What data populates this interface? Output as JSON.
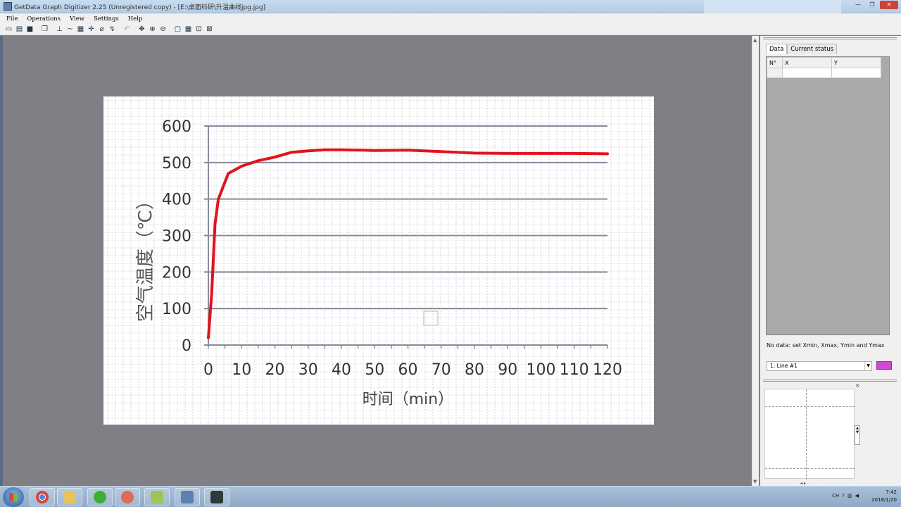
{
  "window": {
    "title": "GetData Graph Digitizer 2.25 (Unregistered copy) - [E:\\桌面科研\\升温曲线jpg.jpg]",
    "controls": {
      "minimize": "—",
      "restore": "❐",
      "close": "✕"
    }
  },
  "menu": [
    "File",
    "Operations",
    "View",
    "Settings",
    "Help"
  ],
  "toolbar": {
    "icons": [
      "open-icon",
      "scan-icon",
      "save-icon",
      "copy-icon",
      "point-capture-icon",
      "line-digitize-icon",
      "area-icon",
      "axis-set-icon",
      "eraser-icon",
      "auto-trace-icon",
      "undo-icon",
      "pan-icon",
      "zoom-in-icon",
      "zoom-out-icon",
      "fit-icon",
      "grid-icon",
      "select-area-icon",
      "clear-icon"
    ]
  },
  "panel": {
    "tabs": [
      "Data",
      "Current status"
    ],
    "table_headers": [
      "N°",
      "X",
      "Y"
    ],
    "status": "No data: set Xmin, Xmax, Ymin and Ymax",
    "line_select": "1: Line #1",
    "line_color": "#d547d5",
    "magnifier_close": "×",
    "hscroll": "◂ ▸"
  },
  "chart_data": {
    "type": "line",
    "title": "",
    "xlabel": "时间（min）",
    "ylabel": "空气温度（℃）",
    "x_ticks": [
      "0",
      "10",
      "20",
      "30",
      "40",
      "50",
      "60",
      "70",
      "80",
      "90",
      "100",
      "110",
      "120"
    ],
    "y_ticks": [
      "0",
      "100",
      "200",
      "300",
      "400",
      "500",
      "600"
    ],
    "xlim": [
      0,
      120
    ],
    "ylim": [
      0,
      600
    ],
    "grid": "horizontal",
    "series_color": "#e0141a",
    "x": [
      0,
      1,
      2,
      3,
      6,
      10,
      15,
      20,
      25,
      30,
      35,
      40,
      50,
      60,
      70,
      80,
      90,
      100,
      110,
      120
    ],
    "values": [
      20,
      140,
      330,
      400,
      470,
      490,
      505,
      515,
      528,
      532,
      535,
      535,
      533,
      534,
      530,
      526,
      525,
      525,
      525,
      524
    ]
  },
  "taskbar": {
    "apps": [
      "chrome-icon",
      "folder-icon",
      "wechat-icon",
      "app-icon",
      "notes-icon",
      "getdata-icon",
      "printer-icon"
    ],
    "tray": {
      "lang": "CH",
      "time": "7:42",
      "date": "2018/1/20"
    }
  }
}
